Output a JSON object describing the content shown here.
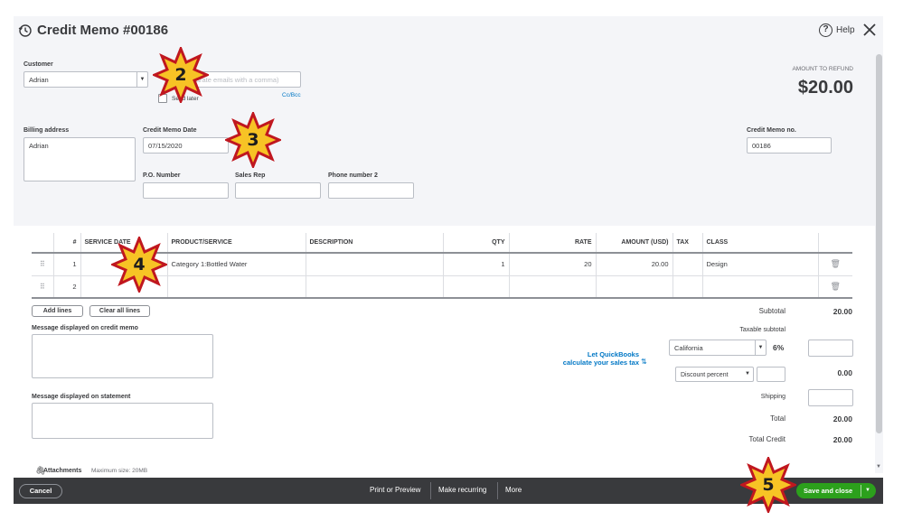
{
  "header": {
    "title": "Credit Memo #00186",
    "help_label": "Help"
  },
  "customer": {
    "label": "Customer",
    "value": "Adrian",
    "email_placeholder": "(Separate emails with a comma)",
    "send_later_label": "Send later",
    "cc_bcc": "Cc/Bcc"
  },
  "amount": {
    "label": "AMOUNT TO REFUND",
    "value": "$20.00"
  },
  "billing": {
    "label": "Billing address",
    "value": "Adrian"
  },
  "memo_date": {
    "label": "Credit Memo Date",
    "value": "07/15/2020"
  },
  "memo_no": {
    "label": "Credit Memo no.",
    "value": "00186"
  },
  "po": {
    "label": "P.O. Number",
    "value": ""
  },
  "sales_rep": {
    "label": "Sales Rep",
    "value": ""
  },
  "phone2": {
    "label": "Phone number 2",
    "value": ""
  },
  "table": {
    "headers": [
      "#",
      "SERVICE DATE",
      "PRODUCT/SERVICE",
      "DESCRIPTION",
      "QTY",
      "RATE",
      "AMOUNT (USD)",
      "TAX",
      "CLASS"
    ],
    "rows": [
      {
        "num": "1",
        "service_date": "",
        "product": "Category 1:Bottled Water",
        "description": "",
        "qty": "1",
        "rate": "20",
        "amount": "20.00",
        "tax": "",
        "class": "Design"
      },
      {
        "num": "2",
        "service_date": "",
        "product": "",
        "description": "",
        "qty": "",
        "rate": "",
        "amount": "",
        "tax": "",
        "class": ""
      }
    ]
  },
  "actions": {
    "add_lines": "Add lines",
    "clear_lines": "Clear all lines"
  },
  "messages": {
    "memo_label": "Message displayed on credit memo",
    "statement_label": "Message displayed on statement"
  },
  "totals": {
    "subtotal_label": "Subtotal",
    "subtotal": "20.00",
    "taxable_label": "Taxable subtotal",
    "tax_region": "California",
    "tax_rate": "6%",
    "discount_type": "Discount percent",
    "discount": "0.00",
    "shipping_label": "Shipping",
    "total_label": "Total",
    "total": "20.00",
    "credit_label": "Total Credit",
    "credit": "20.00"
  },
  "qb_link": {
    "line1": "Let QuickBooks",
    "line2": "calculate your sales tax"
  },
  "attachments": {
    "label": "Attachments",
    "max": "Maximum size: 20MB"
  },
  "footer": {
    "cancel": "Cancel",
    "print": "Print or Preview",
    "recurring": "Make recurring",
    "more": "More",
    "save": "Save and close"
  },
  "badges": [
    "2",
    "3",
    "4",
    "5"
  ],
  "colors": {
    "accent_green": "#2ca01c",
    "link_blue": "#0077c5",
    "footer_dark": "#393a3d",
    "badge_fill": "#f7c325",
    "badge_border": "#c0171f"
  }
}
